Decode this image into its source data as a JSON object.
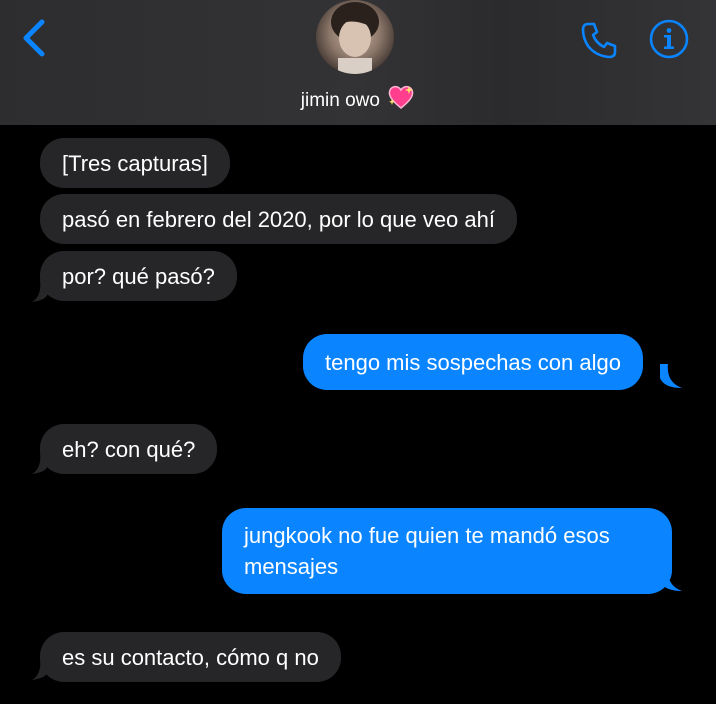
{
  "header": {
    "contact_name": "jimin owo",
    "contact_emoji": "sparkling-heart",
    "back_icon": "chevron-left-icon",
    "call_icon": "phone-icon",
    "info_icon": "info-icon",
    "accent_color": "#0a84ff"
  },
  "messages": [
    {
      "direction": "incoming",
      "text": "[Tres capturas]"
    },
    {
      "direction": "incoming",
      "text": "pasó en febrero del 2020, por lo que veo ahí"
    },
    {
      "direction": "incoming",
      "text": "por? qué pasó?"
    },
    {
      "direction": "outgoing",
      "text": "tengo mis sospechas con algo"
    },
    {
      "direction": "incoming",
      "text": "eh? con qué?"
    },
    {
      "direction": "outgoing",
      "lines": [
        "jungkook no fue quien te mandó esos",
        "mensajes"
      ]
    },
    {
      "direction": "incoming",
      "text": "es su contacto, cómo q no"
    }
  ]
}
